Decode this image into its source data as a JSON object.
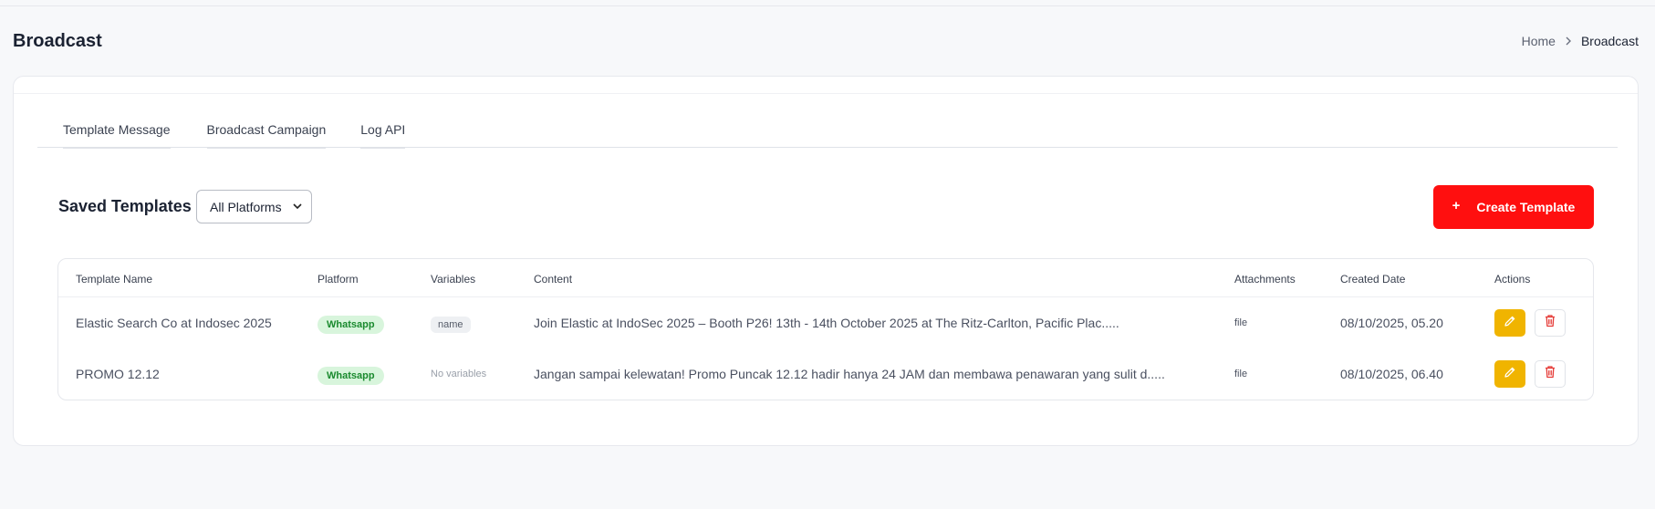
{
  "page": {
    "title": "Broadcast",
    "breadcrumb": {
      "home": "Home",
      "separator": ">",
      "current": "Broadcast"
    }
  },
  "tabs": [
    {
      "label": "Template Message"
    },
    {
      "label": "Broadcast Campaign"
    },
    {
      "label": "Log API"
    }
  ],
  "toolbar": {
    "saved_title": "Saved Templates",
    "platform_filter": {
      "selected": "All Platforms"
    },
    "create_label": "Create Template",
    "create_icon": "plus-icon",
    "accent_color": "#ff0f0f"
  },
  "table": {
    "columns": [
      "Template Name",
      "Platform",
      "Variables",
      "Content",
      "Attachments",
      "Created Date",
      "Actions"
    ],
    "rows": [
      {
        "name": "Elastic Search Co at Indosec 2025",
        "platform": "Whatsapp",
        "variables": "name",
        "content": "Join Elastic at IndoSec 2025 – Booth P26! 13th - 14th October 2025 at The Ritz-Carlton, Pacific Plac.....",
        "attachments": "file",
        "created": "08/10/2025, 05.20"
      },
      {
        "name": "PROMO 12.12",
        "platform": "Whatsapp",
        "variables": "No variables",
        "content": "Jangan sampai kelewatan! Promo Puncak 12.12 hadir hanya 24 JAM dan membawa penawaran yang sulit d.....",
        "attachments": "file",
        "created": "08/10/2025, 06.40"
      }
    ],
    "action_icons": {
      "edit": "pencil-icon",
      "delete": "trash-icon"
    },
    "colors": {
      "edit": "#f0b400",
      "delete": "#e53935",
      "platform_badge": "#1a8a2e"
    }
  }
}
